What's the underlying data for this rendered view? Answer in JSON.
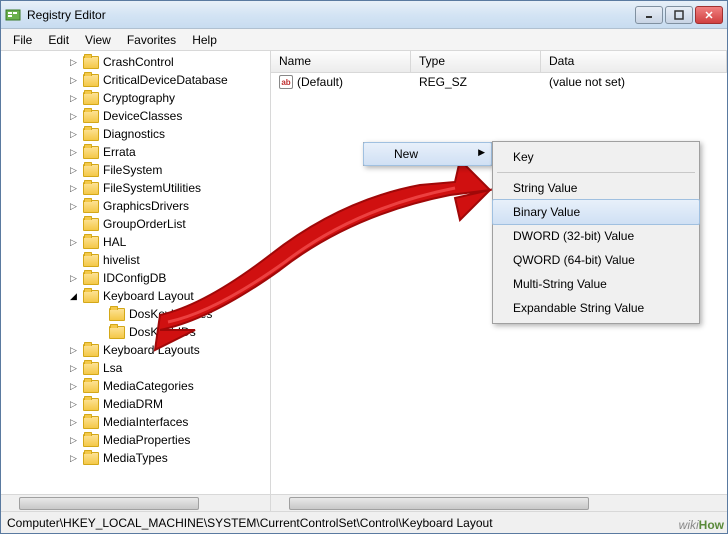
{
  "window": {
    "title": "Registry Editor"
  },
  "menu": {
    "file": "File",
    "edit": "Edit",
    "view": "View",
    "favorites": "Favorites",
    "help": "Help"
  },
  "tree": {
    "items": [
      {
        "label": "CrashControl",
        "expand": "closed"
      },
      {
        "label": "CriticalDeviceDatabase",
        "expand": "closed"
      },
      {
        "label": "Cryptography",
        "expand": "closed"
      },
      {
        "label": "DeviceClasses",
        "expand": "closed"
      },
      {
        "label": "Diagnostics",
        "expand": "closed"
      },
      {
        "label": "Errata",
        "expand": "closed"
      },
      {
        "label": "FileSystem",
        "expand": "closed"
      },
      {
        "label": "FileSystemUtilities",
        "expand": "closed"
      },
      {
        "label": "GraphicsDrivers",
        "expand": "closed"
      },
      {
        "label": "GroupOrderList",
        "expand": "none"
      },
      {
        "label": "HAL",
        "expand": "closed"
      },
      {
        "label": "hivelist",
        "expand": "none"
      },
      {
        "label": "IDConfigDB",
        "expand": "closed"
      },
      {
        "label": "Keyboard Layout",
        "expand": "open",
        "children": [
          {
            "label": "DosKeybCodes"
          },
          {
            "label": "DosKeybIDs"
          }
        ]
      },
      {
        "label": "Keyboard Layouts",
        "expand": "closed"
      },
      {
        "label": "Lsa",
        "expand": "closed"
      },
      {
        "label": "MediaCategories",
        "expand": "closed"
      },
      {
        "label": "MediaDRM",
        "expand": "closed"
      },
      {
        "label": "MediaInterfaces",
        "expand": "closed"
      },
      {
        "label": "MediaProperties",
        "expand": "closed"
      },
      {
        "label": "MediaTypes",
        "expand": "closed"
      }
    ]
  },
  "list": {
    "headers": {
      "name": "Name",
      "type": "Type",
      "data": "Data"
    },
    "rows": [
      {
        "name": "(Default)",
        "type": "REG_SZ",
        "data": "(value not set)"
      }
    ]
  },
  "context": {
    "new": "New",
    "sub": {
      "key": "Key",
      "string": "String Value",
      "binary": "Binary Value",
      "dword": "DWORD (32-bit) Value",
      "qword": "QWORD (64-bit) Value",
      "multi": "Multi-String Value",
      "expand": "Expandable String Value"
    }
  },
  "status": {
    "path": "Computer\\HKEY_LOCAL_MACHINE\\SYSTEM\\CurrentControlSet\\Control\\Keyboard Layout"
  },
  "watermark": {
    "prefix": "wiki",
    "suffix": "How"
  }
}
